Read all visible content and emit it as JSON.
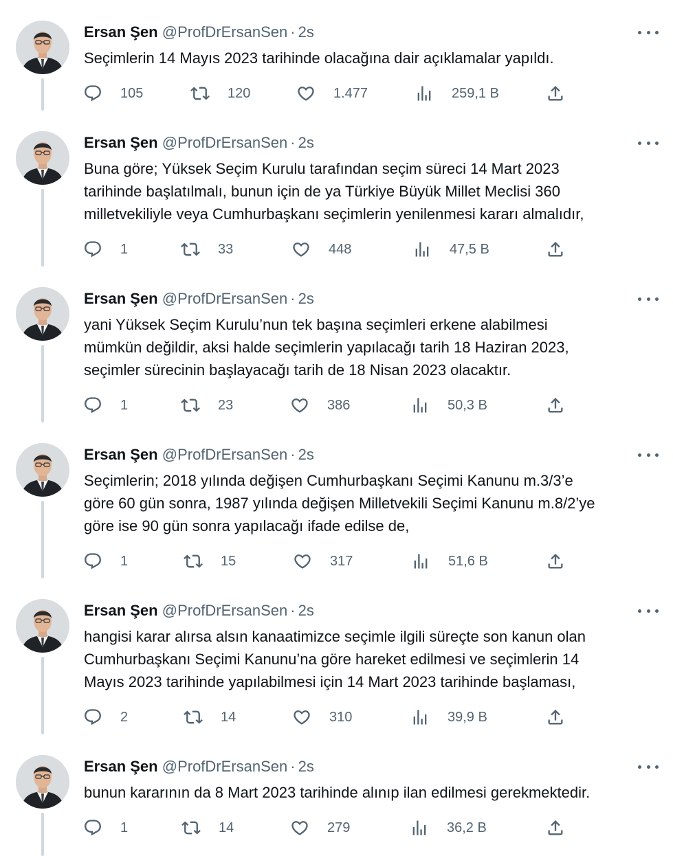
{
  "author": {
    "name": "Ersan Şen",
    "handle": "@ProfDrErsanSen",
    "separator": "·"
  },
  "icons": {
    "reply": "reply-icon",
    "retweet": "retweet-icon",
    "like": "like-icon",
    "views": "views-icon",
    "share": "share-icon",
    "more": "more-icon"
  },
  "colors": {
    "text": "#0f1419",
    "secondary": "#536471",
    "thread_line": "#cfd9de"
  },
  "tweets": [
    {
      "time": "2s",
      "text": "Seçimlerin 14 Mayıs 2023 tarihinde olacağına dair açıklamalar yapıldı.",
      "replies": "105",
      "retweets": "120",
      "likes": "1.477",
      "views": "259,1 B"
    },
    {
      "time": "2s",
      "text": "Buna göre; Yüksek Seçim Kurulu tarafından seçim süreci 14 Mart 2023\ntarihinde başlatılmalı, bunun için de ya Türkiye Büyük Millet Meclisi 360\nmilletvekiliyle veya Cumhurbaşkanı seçimlerin yenilenmesi kararı almalıdır,",
      "replies": "1",
      "retweets": "33",
      "likes": "448",
      "views": "47,5 B"
    },
    {
      "time": "2s",
      "text": "yani Yüksek Seçim Kurulu’nun tek başına seçimleri erkene alabilmesi\nmümkün değildir, aksi halde seçimlerin yapılacağı tarih 18 Haziran 2023,\nseçimler sürecinin başlayacağı tarih de 18 Nisan 2023 olacaktır.",
      "replies": "1",
      "retweets": "23",
      "likes": "386",
      "views": "50,3 B"
    },
    {
      "time": "2s",
      "text": "Seçimlerin; 2018 yılında değişen Cumhurbaşkanı Seçimi Kanunu m.3/3’e\ngöre 60 gün sonra, 1987 yılında değişen Milletvekili Seçimi Kanunu m.8/2’ye\ngöre ise 90 gün sonra yapılacağı ifade edilse de,",
      "replies": "1",
      "retweets": "15",
      "likes": "317",
      "views": "51,6 B"
    },
    {
      "time": "2s",
      "text": "hangisi karar alırsa alsın kanaatimizce seçimle ilgili süreçte son kanun olan\nCumhurbaşkanı Seçimi Kanunu’na göre hareket edilmesi ve seçimlerin 14\nMayıs 2023 tarihinde yapılabilmesi için 14 Mart 2023 tarihinde başlaması,",
      "replies": "2",
      "retweets": "14",
      "likes": "310",
      "views": "39,9 B"
    },
    {
      "time": "2s",
      "text": "bunun kararının da 8 Mart 2023 tarihinde alınıp ilan edilmesi gerekmektedir.",
      "replies": "1",
      "retweets": "14",
      "likes": "279",
      "views": "36,2 B"
    }
  ]
}
